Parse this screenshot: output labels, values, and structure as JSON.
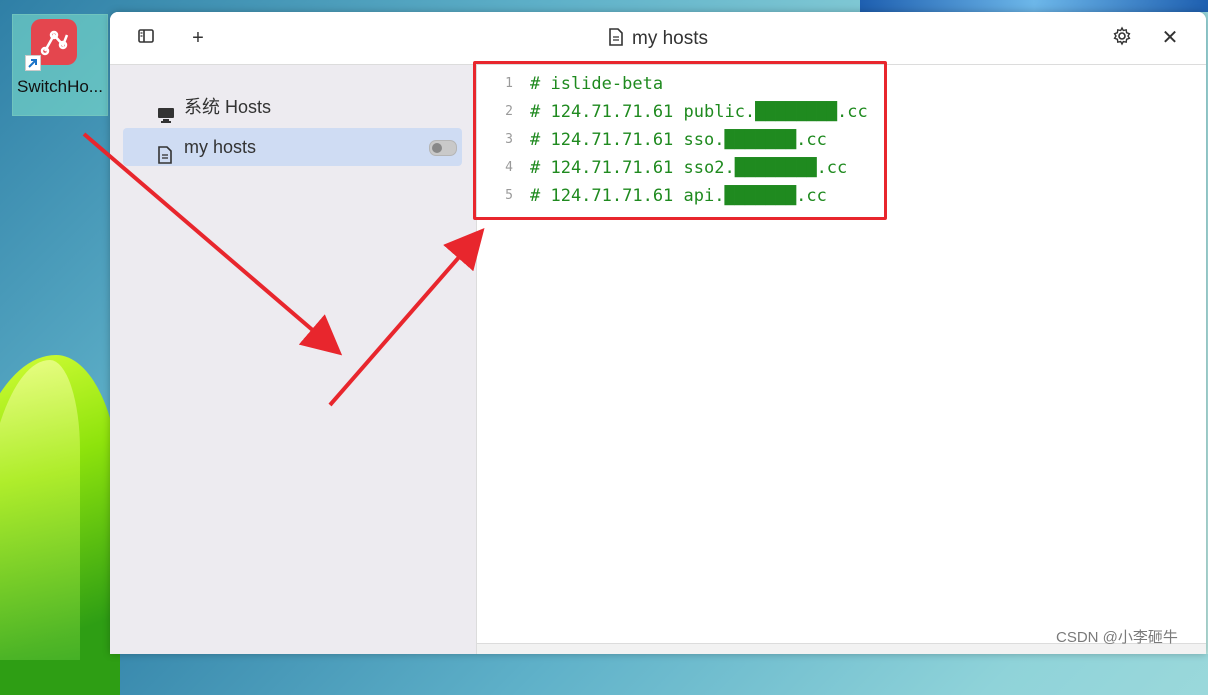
{
  "desktop": {
    "shortcut_label": "SwitchHo..."
  },
  "window": {
    "title": "my hosts",
    "buttons": {
      "toggle_sidebar": "sidebar-icon",
      "add": "+",
      "settings": "gear-icon",
      "close": "✕"
    }
  },
  "sidebar": {
    "items": [
      {
        "label": "系统 Hosts",
        "icon": "monitor-icon",
        "active": false
      },
      {
        "label": "my hosts",
        "icon": "document-icon",
        "active": true,
        "toggle": "off"
      }
    ]
  },
  "editor": {
    "lines": [
      {
        "n": "1",
        "text": "# islide-beta"
      },
      {
        "n": "2",
        "text": "# 124.71.71.61 public.████████.cc"
      },
      {
        "n": "3",
        "text": "# 124.71.71.61 sso.███████.cc"
      },
      {
        "n": "4",
        "text": "# 124.71.71.61 sso2.████████.cc"
      },
      {
        "n": "5",
        "text": "# 124.71.71.61 api.███████.cc"
      }
    ]
  },
  "watermark": "CSDN @小李砸牛",
  "colors": {
    "annotation_red": "#e8262d",
    "code_green": "#1f8a1f",
    "sidebar_active": "#cfdcf3"
  }
}
